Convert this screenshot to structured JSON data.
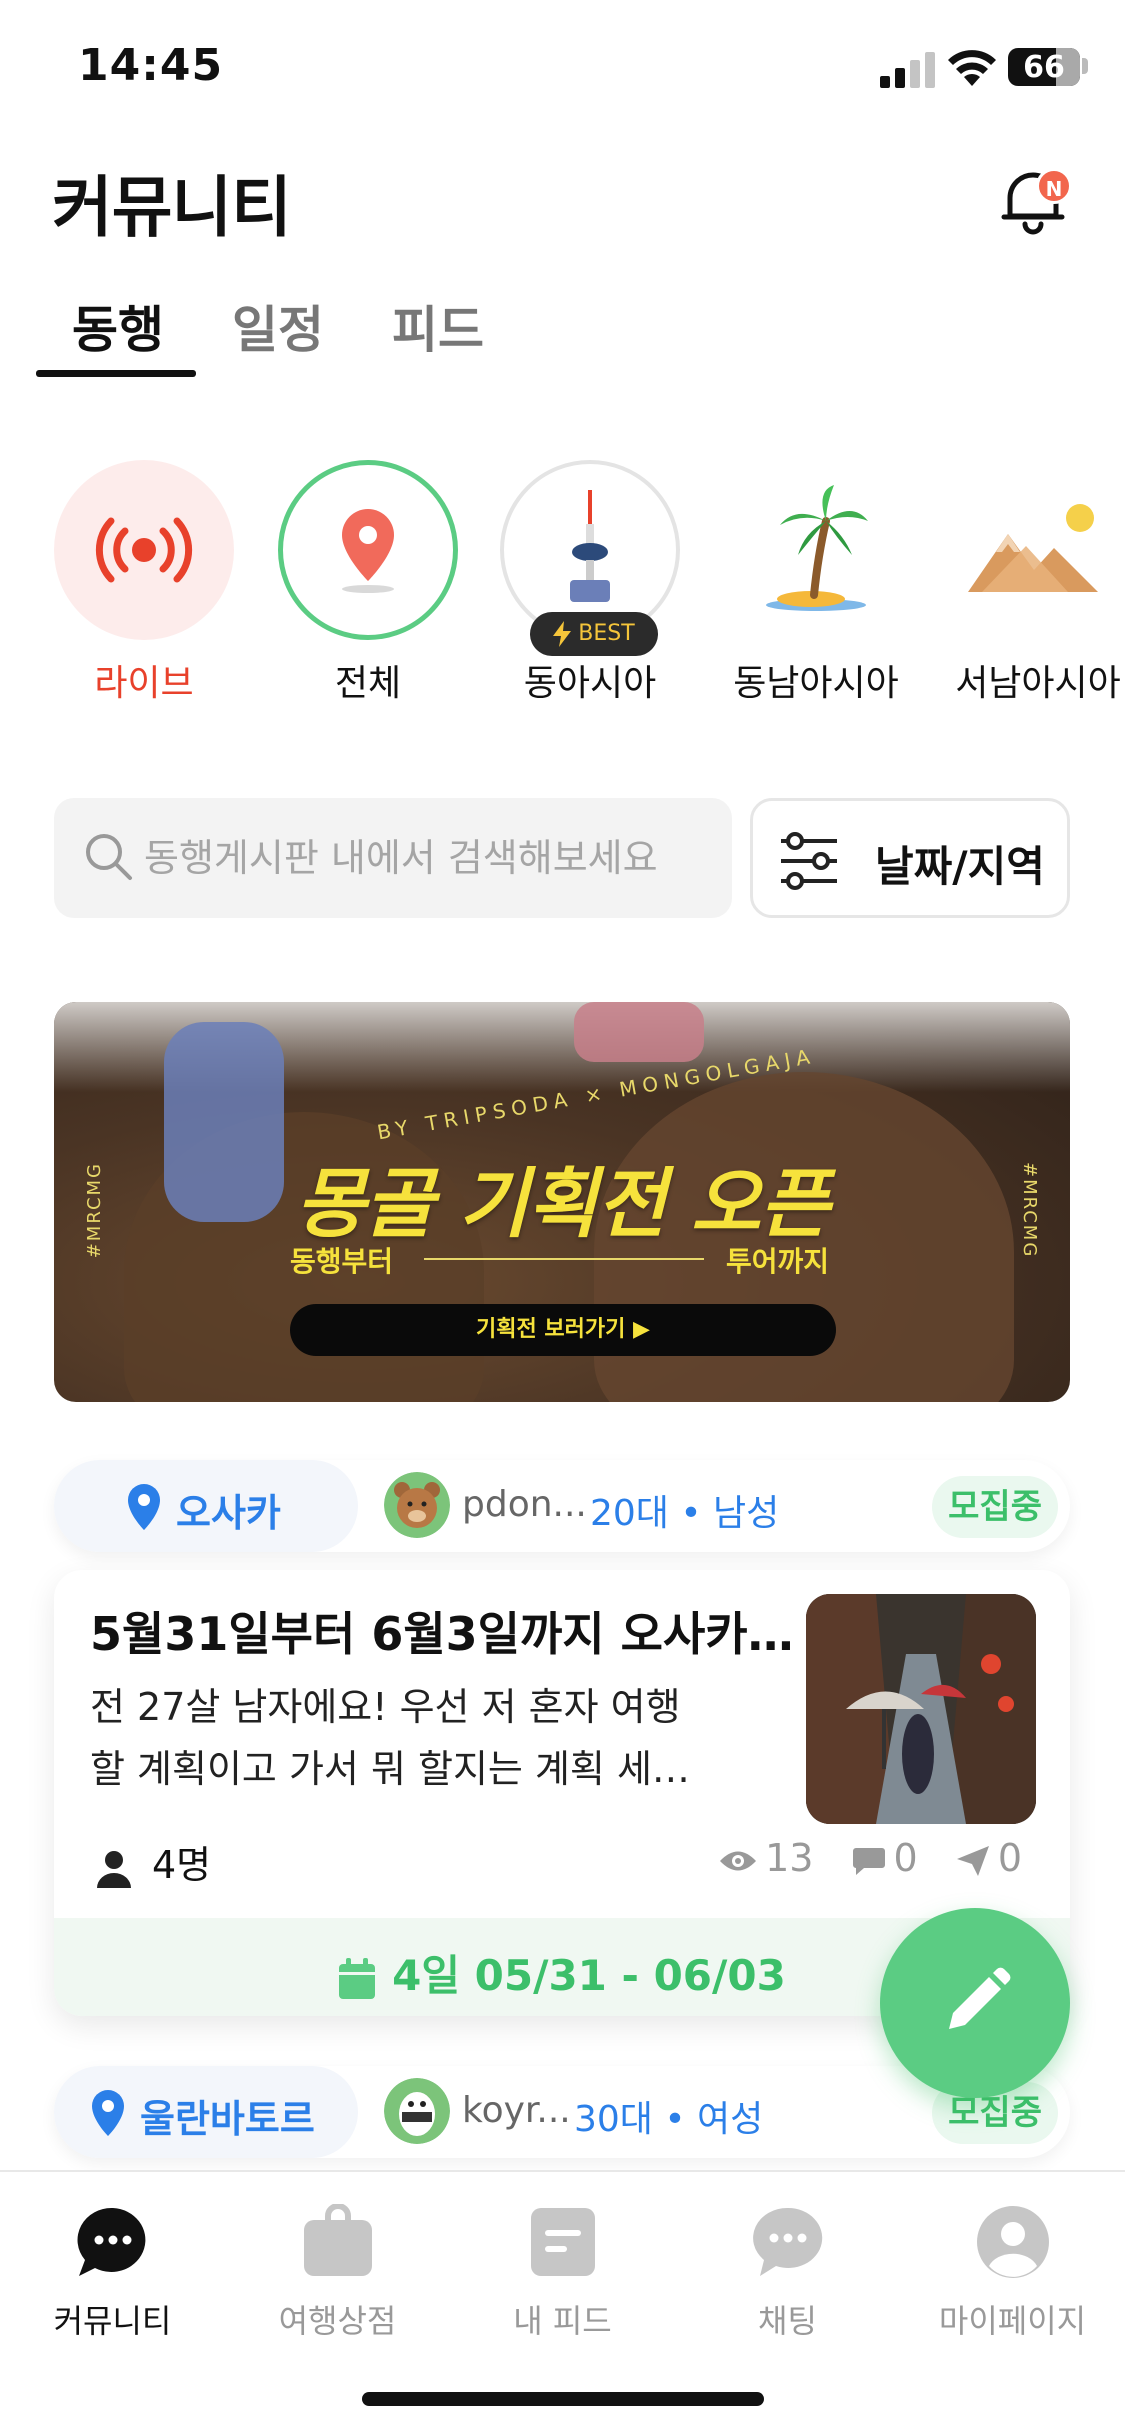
{
  "status_bar": {
    "time": "14:45",
    "battery": "66",
    "battery_level": 0.66
  },
  "header": {
    "title": "커뮤니티",
    "notification_badge": "N"
  },
  "tabs": [
    {
      "label": "동행",
      "active": true
    },
    {
      "label": "일정",
      "active": false
    },
    {
      "label": "피드",
      "active": false
    }
  ],
  "categories": [
    {
      "label": "라이브",
      "icon": "live-broadcast-icon"
    },
    {
      "label": "전체",
      "icon": "map-pin-icon"
    },
    {
      "label": "동아시아",
      "icon": "tower-icon",
      "badge": "BEST"
    },
    {
      "label": "동남아시아",
      "icon": "palm-tree-icon"
    },
    {
      "label": "서남아시아",
      "icon": "mountains-icon"
    }
  ],
  "search": {
    "placeholder": "동행게시판 내에서 검색해보세요",
    "filter_label": "날짜/지역"
  },
  "banner": {
    "arc_text": "BY TRIPSODA × MONGOLGAJA",
    "headline": "몽골 기획전 오픈",
    "sub_left": "동행부터",
    "sub_right": "투어까지",
    "cta": "기획전 보러가기 ▶",
    "side_tag": "#MRCMG"
  },
  "posts": [
    {
      "location": "오사카",
      "user": "pdon...",
      "demographic": "20대 • 남성",
      "status": "모집중",
      "title": "5월31일부터 6월3일까지 오사카…",
      "body_line1": "전 27살 남자에요! 우선 저 혼자 여행",
      "body_line2": "할 계획이고 가서 뭐 할지는 계획 세…",
      "people": "4명",
      "views": "13",
      "comments": "0",
      "shares": "0",
      "date": "4일 05/31 - 06/03"
    },
    {
      "location": "울란바토르",
      "user": "koyr...",
      "demographic": "30대 • 여성",
      "status": "모집중"
    }
  ],
  "bottom_nav": [
    {
      "label": "커뮤니티",
      "active": true
    },
    {
      "label": "여행상점",
      "active": false
    },
    {
      "label": "내 피드",
      "active": false
    },
    {
      "label": "채팅",
      "active": false
    },
    {
      "label": "마이페이지",
      "active": false
    }
  ],
  "colors": {
    "accent_green": "#5bcc83",
    "live_red": "#e8412b",
    "link_blue": "#2b7fe8",
    "banner_yellow": "#f6e23c"
  }
}
